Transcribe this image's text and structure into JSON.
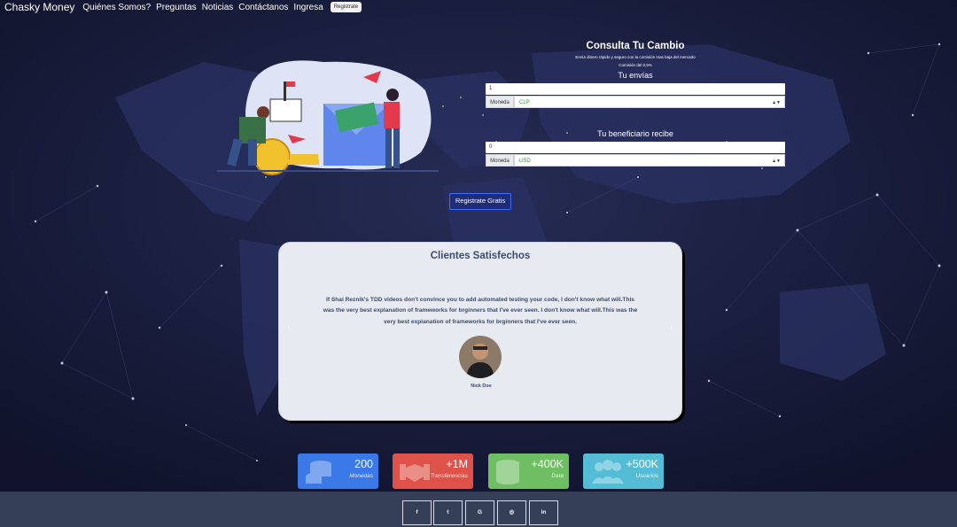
{
  "nav": {
    "brand": "Chasky Money",
    "links": [
      "Quiénes Somos?",
      "Preguntas",
      "Noticias",
      "Contáctanos",
      "Ingresa"
    ],
    "register": "Registrate"
  },
  "converter": {
    "title": "Consulta Tu Cambio",
    "subtitle": "Envía dinero rápido y seguro con la comisión mas baja del mercado",
    "commission": "Comisión del 0,5%",
    "send_label": "Tu envías",
    "send_value": "1",
    "currency_label": "Moneda",
    "send_currency": "CLP",
    "receive_label": "Tu beneficiario recibe",
    "receive_value": "0",
    "receive_currency": "USD"
  },
  "cta": {
    "label": "Registrate Gratis"
  },
  "testimonials": {
    "title": "Clientes Satisfechos",
    "text": "If Shai Reznik's TDD videos don't convince you to add automated testing your code, I don't know what will.This was the very best explanation of frameworks for brginners that I've ever seen. I don't know what will.This was the very best explanation of frameworks for brginners that I've ever seen.",
    "name": "Nick Doe",
    "prev": "‹",
    "next": "›"
  },
  "stats": [
    {
      "value": "200",
      "label": "Monedas",
      "color": "#3b79e8",
      "icon": "coins-icon"
    },
    {
      "value": "+1M",
      "label": "Transferencias",
      "color": "#df5249",
      "icon": "handshake-icon"
    },
    {
      "value": "+400K",
      "label": "Data",
      "color": "#6fbe63",
      "icon": "database-icon"
    },
    {
      "value": "+500K",
      "label": "Usuarios",
      "color": "#55bcd6",
      "icon": "users-icon"
    }
  ],
  "social": [
    "f",
    "t",
    "G",
    "◎",
    "in"
  ],
  "colors": {
    "bg": "#131733",
    "footer": "#363f58",
    "accent": "#3f6bff"
  }
}
